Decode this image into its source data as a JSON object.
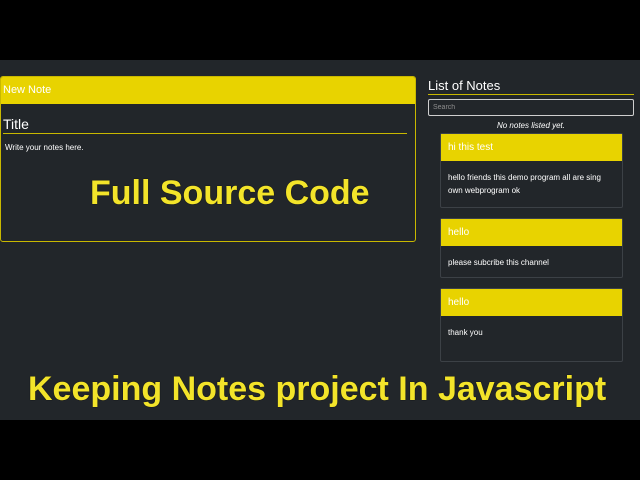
{
  "editor": {
    "header": "New Note",
    "title": "Title",
    "placeholder": "Write your notes here."
  },
  "overlay": {
    "line1": "Full Source Code",
    "line2": "Keeping Notes project In Javascript"
  },
  "list": {
    "title": "List of Notes",
    "search_placeholder": "Search",
    "empty_message": "No notes listed yet.",
    "notes": [
      {
        "title": "hi this test",
        "body": "hello friends this demo program all are sing own webprogram ok"
      },
      {
        "title": "hello",
        "body": "please subcribe this channel"
      },
      {
        "title": "hello",
        "body": "thank you"
      }
    ]
  },
  "colors": {
    "accent": "#e8d300",
    "background": "#22262a",
    "overlay_text": "#f3e42a"
  }
}
